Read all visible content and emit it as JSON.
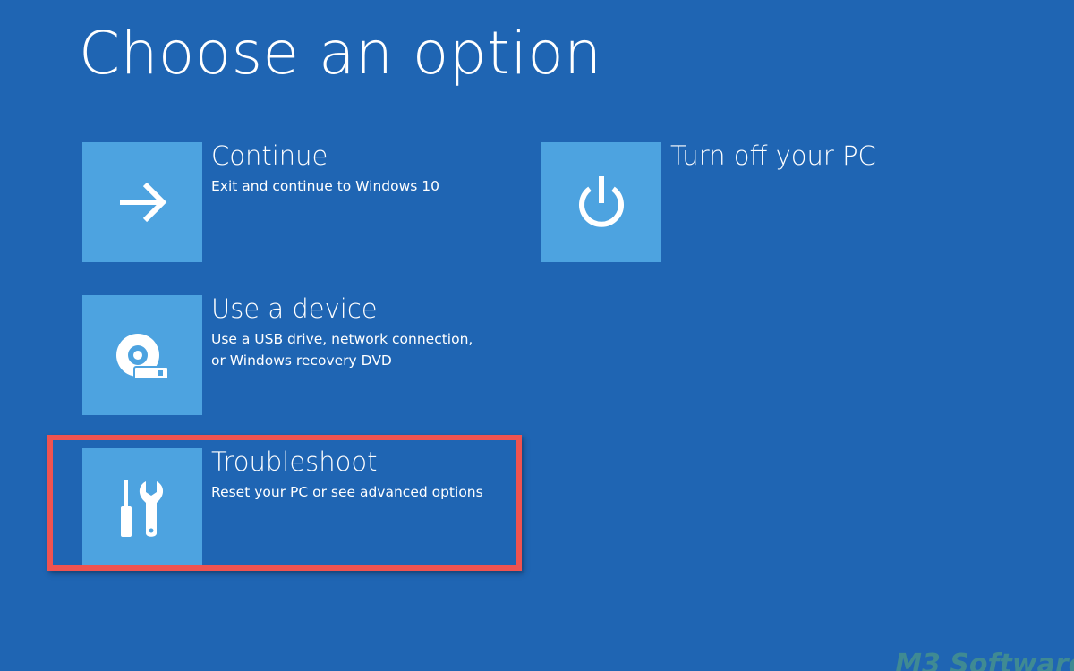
{
  "page": {
    "title": "Choose an option",
    "background_color": "#1f65b3",
    "tile_color": "#4da3e0",
    "highlight_color": "#ef5350"
  },
  "options": [
    {
      "id": "continue",
      "label": "Continue",
      "description_lines": [
        "Exit and continue to Windows 10"
      ],
      "icon": "arrow-right-icon"
    },
    {
      "id": "use-device",
      "label": "Use a device",
      "description_lines": [
        "Use a USB drive, network connection,",
        "or Windows recovery DVD"
      ],
      "icon": "disc-drive-icon"
    },
    {
      "id": "troubleshoot",
      "label": "Troubleshoot",
      "description_lines": [
        "Reset your PC or see advanced options"
      ],
      "icon": "tools-icon",
      "highlighted": true
    },
    {
      "id": "turn-off",
      "label": "Turn off your PC",
      "description_lines": [],
      "icon": "power-icon"
    }
  ],
  "watermark": {
    "text": "M3 Software"
  }
}
